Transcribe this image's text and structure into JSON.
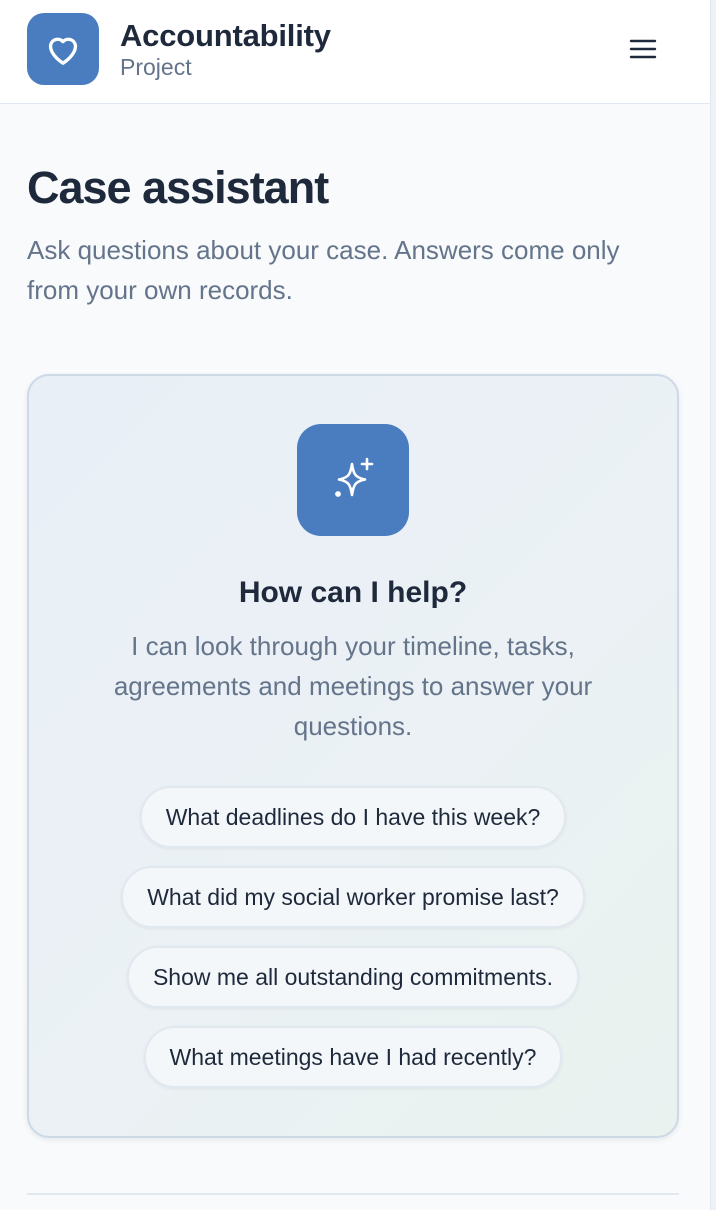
{
  "header": {
    "brand_title": "Accountability",
    "brand_subtitle": "Project",
    "logo_icon": "heart-icon",
    "menu_icon": "hamburger-menu-icon"
  },
  "page": {
    "title": "Case assistant",
    "description": "Ask questions about your case. Answers come only from your own records."
  },
  "assistant_card": {
    "icon": "sparkles-icon",
    "title": "How can I help?",
    "description": "I can look through your timeline, tasks, agreements and meetings to answer your questions.",
    "suggestions": [
      "What deadlines do I have this week?",
      "What did my social worker promise last?",
      "Show me all outstanding commitments.",
      "What meetings have I had recently?"
    ]
  },
  "colors": {
    "brand_blue": "#4a7dbf",
    "text_dark": "#1e293b",
    "text_muted": "#64748b",
    "border": "#e2e8f0",
    "background": "#f8fafc"
  }
}
